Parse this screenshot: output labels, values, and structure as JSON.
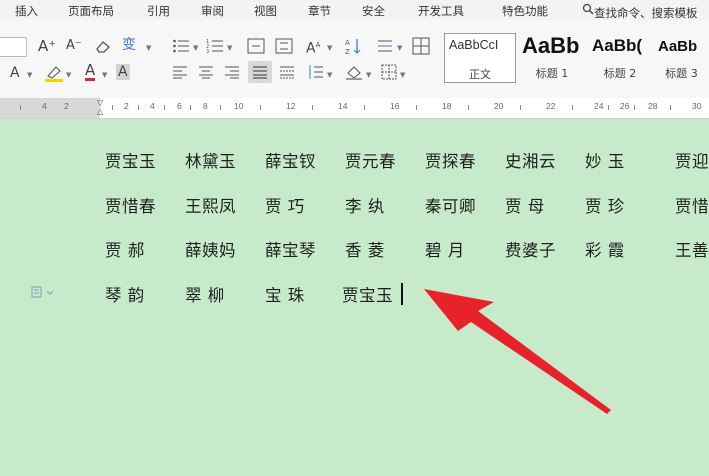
{
  "menu": [
    "插入",
    "页面布局",
    "引用",
    "审阅",
    "视图",
    "章节",
    "安全",
    "开发工具",
    "特色功能"
  ],
  "search_text": "查找命令、搜索模板",
  "ribbon": {
    "font_grow": "A⁺",
    "font_shrink": "A⁻",
    "phonetic": "变",
    "text_effect": "A",
    "font_color": "A",
    "char_shading": "A",
    "sort_icon": "sort-icon",
    "styles": [
      {
        "sample": "AaBbCcI",
        "name": "正文"
      },
      {
        "sample": "AaBb",
        "name": "标题 1"
      },
      {
        "sample": "AaBb(",
        "name": "标题 2"
      },
      {
        "sample": "AaBb",
        "name": "标题 3"
      }
    ]
  },
  "ruler": [
    "4",
    "2",
    "2",
    "4",
    "6",
    "8",
    "10",
    "12",
    "14",
    "16",
    "18",
    "20",
    "22",
    "24",
    "26",
    "28",
    "30"
  ],
  "document": {
    "lines": [
      [
        "贾宝玉",
        "林黛玉",
        "薛宝钗",
        "贾元春",
        "贾探春",
        "史湘云",
        "妙 玉",
        "贾迎"
      ],
      [
        "贾惜春",
        "王熙凤",
        "贾 巧",
        "李 纨",
        "秦可卿",
        "贾 母",
        "贾 珍",
        "贾惜"
      ],
      [
        "贾 郝",
        "薛姨妈",
        "薛宝琴",
        "香 菱",
        "碧 月",
        "费婆子",
        "彩 霞",
        "王善"
      ],
      [
        "琴 韵",
        "翠 柳",
        "宝 珠",
        "贾宝玉"
      ]
    ]
  },
  "colors": {
    "page_background": "#c7eacb",
    "ribbon_background": "#f7f7f7",
    "arrow": "#e8222a"
  }
}
